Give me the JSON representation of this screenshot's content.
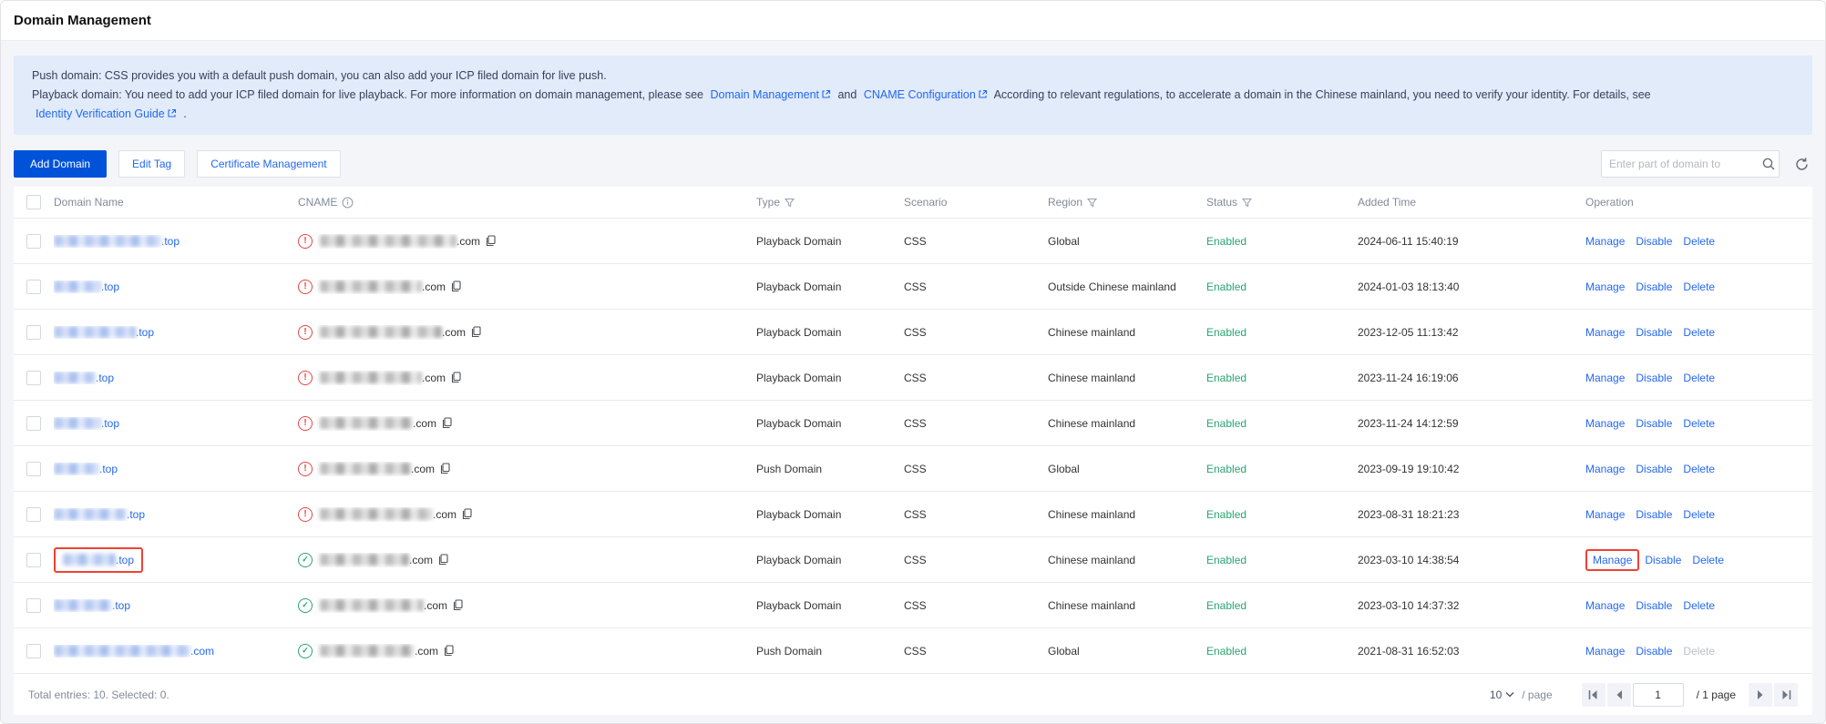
{
  "page": {
    "title": "Domain Management"
  },
  "banner": {
    "line1": "Push domain: CSS provides you with a default push domain, you can also add your ICP filed domain for live push.",
    "line2_pre": "Playback domain: You need to add your ICP filed domain for live playback. For more information on domain management, please see",
    "link_domain_mgmt": "Domain Management",
    "conj": "and",
    "link_cname": "CNAME Configuration",
    "line2_mid": "According to relevant regulations, to accelerate a domain in the Chinese mainland, you need to verify your identity. For details, see",
    "link_identity": "Identity Verification Guide",
    "line2_end": "."
  },
  "toolbar": {
    "add_domain": "Add Domain",
    "edit_tag": "Edit Tag",
    "cert_mgmt": "Certificate Management",
    "search_placeholder": "Enter part of domain to"
  },
  "table": {
    "headers": {
      "domain": "Domain Name",
      "cname": "CNAME",
      "type": "Type",
      "scenario": "Scenario",
      "region": "Region",
      "status": "Status",
      "added": "Added Time",
      "operation": "Operation"
    },
    "ops": {
      "manage": "Manage",
      "disable": "Disable",
      "delete": "Delete"
    },
    "rows": [
      {
        "domain_suffix": ".top",
        "domain_w": 118,
        "cname_status": "warning",
        "cname_suffix": ".com",
        "cname_w": 150,
        "type": "Playback Domain",
        "scenario": "CSS",
        "region": "Global",
        "status": "Enabled",
        "added": "2024-06-11 15:40:19",
        "highlight_domain": false,
        "highlight_manage": false,
        "delete_disabled": false
      },
      {
        "domain_suffix": ".top",
        "domain_w": 52,
        "cname_status": "warning",
        "cname_suffix": ".com",
        "cname_w": 112,
        "type": "Playback Domain",
        "scenario": "CSS",
        "region": "Outside Chinese mainland",
        "status": "Enabled",
        "added": "2024-01-03 18:13:40",
        "highlight_domain": false,
        "highlight_manage": false,
        "delete_disabled": false
      },
      {
        "domain_suffix": ".top",
        "domain_w": 90,
        "cname_status": "warning",
        "cname_suffix": ".com",
        "cname_w": 134,
        "type": "Playback Domain",
        "scenario": "CSS",
        "region": "Chinese mainland",
        "status": "Enabled",
        "added": "2023-12-05 11:13:42",
        "highlight_domain": false,
        "highlight_manage": false,
        "delete_disabled": false
      },
      {
        "domain_suffix": ".top",
        "domain_w": 46,
        "cname_status": "warning",
        "cname_suffix": ".com",
        "cname_w": 112,
        "type": "Playback Domain",
        "scenario": "CSS",
        "region": "Chinese mainland",
        "status": "Enabled",
        "added": "2023-11-24 16:19:06",
        "highlight_domain": false,
        "highlight_manage": false,
        "delete_disabled": false
      },
      {
        "domain_suffix": ".top",
        "domain_w": 52,
        "cname_status": "warning",
        "cname_suffix": ".com",
        "cname_w": 102,
        "type": "Playback Domain",
        "scenario": "CSS",
        "region": "Chinese mainland",
        "status": "Enabled",
        "added": "2023-11-24 14:12:59",
        "highlight_domain": false,
        "highlight_manage": false,
        "delete_disabled": false
      },
      {
        "domain_suffix": ".top",
        "domain_w": 50,
        "cname_status": "warning",
        "cname_suffix": ".com",
        "cname_w": 100,
        "type": "Push Domain",
        "scenario": "CSS",
        "region": "Global",
        "status": "Enabled",
        "added": "2023-09-19 19:10:42",
        "highlight_domain": false,
        "highlight_manage": false,
        "delete_disabled": false
      },
      {
        "domain_suffix": ".top",
        "domain_w": 80,
        "cname_status": "warning",
        "cname_suffix": ".com",
        "cname_w": 124,
        "type": "Playback Domain",
        "scenario": "CSS",
        "region": "Chinese mainland",
        "status": "Enabled",
        "added": "2023-08-31 18:21:23",
        "highlight_domain": false,
        "highlight_manage": false,
        "delete_disabled": false
      },
      {
        "domain_suffix": ".top",
        "domain_w": 58,
        "cname_status": "verified",
        "cname_suffix": ".com",
        "cname_w": 98,
        "type": "Playback Domain",
        "scenario": "CSS",
        "region": "Chinese mainland",
        "status": "Enabled",
        "added": "2023-03-10 14:38:54",
        "highlight_domain": true,
        "highlight_manage": true,
        "delete_disabled": false
      },
      {
        "domain_suffix": ".top",
        "domain_w": 64,
        "cname_status": "verified",
        "cname_suffix": ".com",
        "cname_w": 114,
        "type": "Playback Domain",
        "scenario": "CSS",
        "region": "Chinese mainland",
        "status": "Enabled",
        "added": "2023-03-10 14:37:32",
        "highlight_domain": false,
        "highlight_manage": false,
        "delete_disabled": false
      },
      {
        "domain_suffix": ".com",
        "domain_w": 150,
        "cname_status": "verified",
        "cname_suffix": ".com",
        "cname_w": 104,
        "type": "Push Domain",
        "scenario": "CSS",
        "region": "Global",
        "status": "Enabled",
        "added": "2021-08-31 16:52:03",
        "highlight_domain": false,
        "highlight_manage": false,
        "delete_disabled": true
      }
    ]
  },
  "footer": {
    "summary": "Total entries: 10. Selected: 0.",
    "page_size": "10",
    "per_page": "/ page",
    "current_page": "1",
    "total_pages": "/ 1 page"
  },
  "colors": {
    "accent": "#0052d9",
    "link": "#2468f2",
    "success": "#2ba471",
    "warning": "#e54545",
    "highlight_box": "#f04134",
    "banner_bg": "#e1ebfa"
  }
}
